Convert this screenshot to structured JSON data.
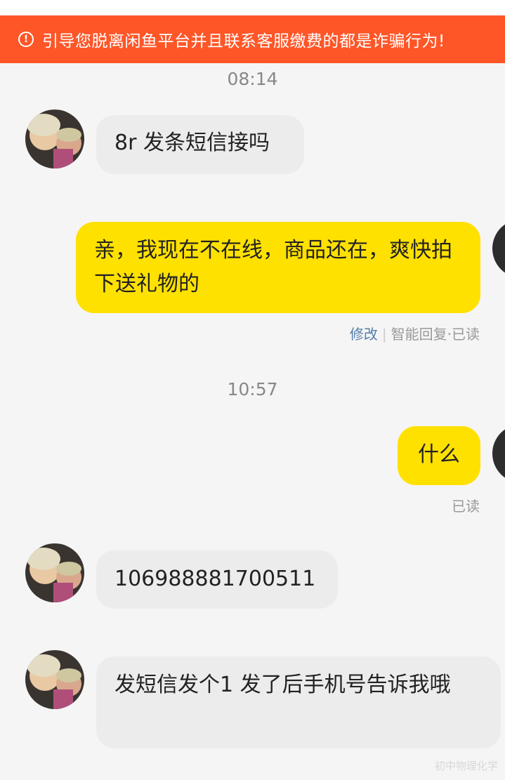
{
  "banner": {
    "icon": "alert-circle-icon",
    "text": "引导您脱离闲鱼平台并且联系客服缴费的都是诈骗行为!"
  },
  "messages": {
    "time1": "08:14",
    "m1": "8r 发条短信接吗",
    "m2": "亲，我现在不在线，商品还在，爽快拍下送礼物的",
    "m2_edit": "修改",
    "m2_status": "智能回复·已读",
    "time2": "10:57",
    "m3": "什么",
    "m3_status": "已读",
    "m4": "106988881700511",
    "m5": "发短信发个1 发了后手机号告诉我哦"
  },
  "colors": {
    "banner": "#ff5628",
    "outgoing_bubble": "#ffe100",
    "incoming_bubble": "#ececec"
  },
  "watermark": "初中物理化学"
}
